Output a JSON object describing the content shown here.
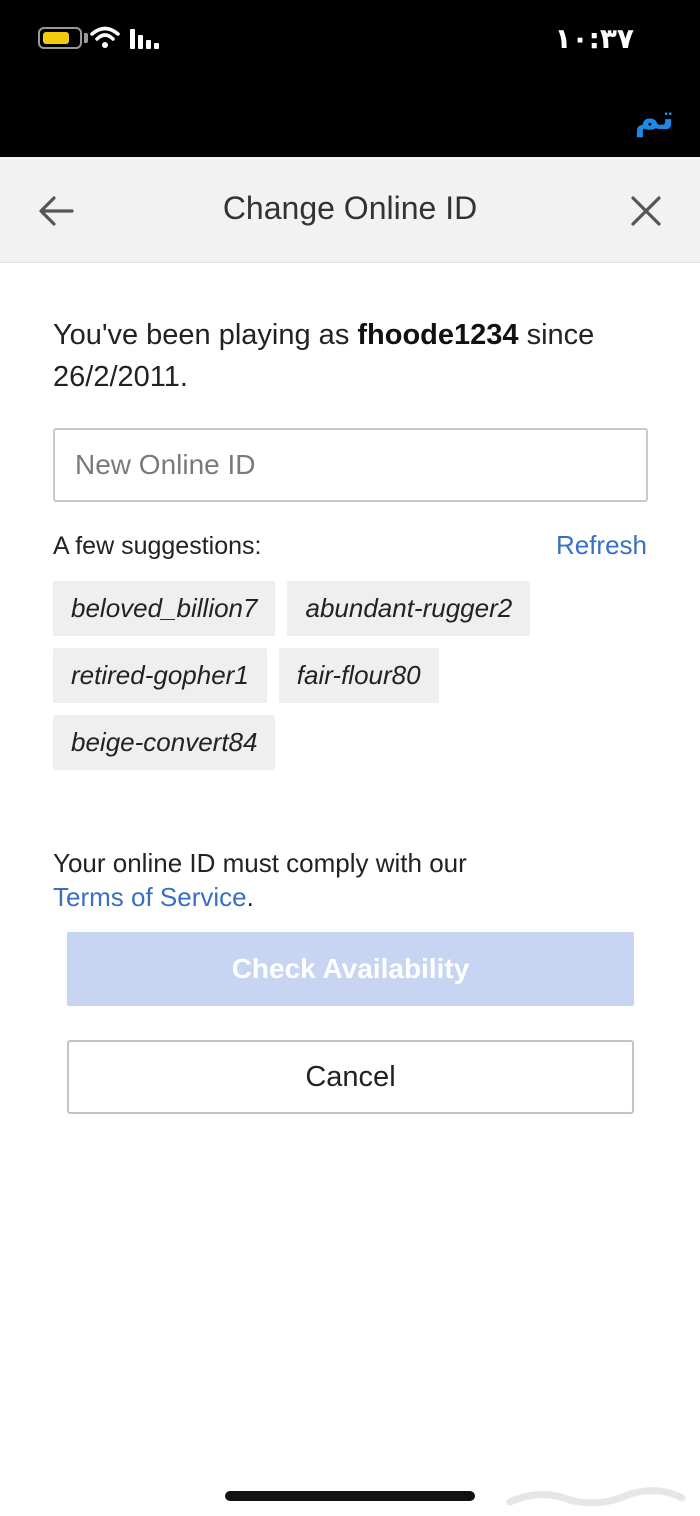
{
  "status_bar": {
    "time": "١٠:٣٧",
    "done_label": "تم",
    "icons": [
      "battery-icon",
      "wifi-icon",
      "signal-icon"
    ]
  },
  "header": {
    "title": "Change Online ID",
    "back_icon": "arrow-left-icon",
    "close_icon": "close-icon"
  },
  "intro": {
    "prefix": "You've been playing as ",
    "online_id": "fhoode1234",
    "middle": " since",
    "date": "26/2/2011."
  },
  "input": {
    "placeholder": "New Online ID",
    "value": ""
  },
  "suggestions": {
    "label": "A few suggestions:",
    "refresh_label": "Refresh",
    "rows": [
      [
        "beloved_billion7",
        "abundant-rugger2"
      ],
      [
        "retired-gopher1",
        "fair-flour80"
      ],
      [
        "beige-convert84"
      ]
    ]
  },
  "terms": {
    "text": "Your online ID must comply with our",
    "link": "Terms of Service",
    "suffix": "."
  },
  "buttons": {
    "check": "Check Availability",
    "cancel": "Cancel"
  },
  "colors": {
    "accent": "#3a6fc4",
    "button_disabled": "#c7d5f3",
    "battery": "#f3c90e"
  }
}
